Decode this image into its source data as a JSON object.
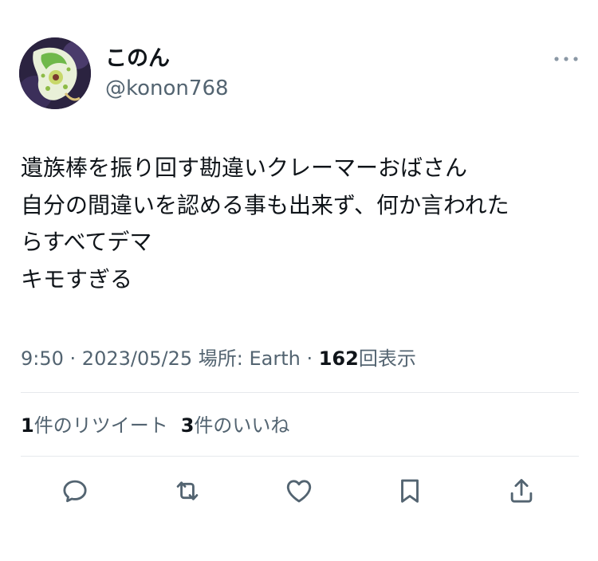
{
  "author": {
    "name": "このん",
    "handle": "@konon768"
  },
  "tweet": {
    "lines": [
      "遺族棒を振り回す勘違いクレーマーおばさん",
      "自分の間違いを認める事も出来ず、何か言われた",
      "らすべてデマ",
      "キモすぎる"
    ]
  },
  "meta": {
    "time": "9:50",
    "dot1": " · ",
    "date": "2023/05/25",
    "place": " 場所: Earth",
    "dot2": " · ",
    "views_count": "162",
    "views_label": "回表示"
  },
  "stats": {
    "retweets_count": "1",
    "retweets_label": "件のリツイート",
    "likes_count": "3",
    "likes_label": "件のいいね"
  },
  "icons": {
    "more": "more-horizontal-icon",
    "reply": "reply-icon",
    "retweet": "retweet-icon",
    "like": "heart-icon",
    "bookmark": "bookmark-icon",
    "share": "share-icon"
  },
  "colors": {
    "text": "#0f1419",
    "secondary": "#536471",
    "divider": "#e6e9ec"
  }
}
